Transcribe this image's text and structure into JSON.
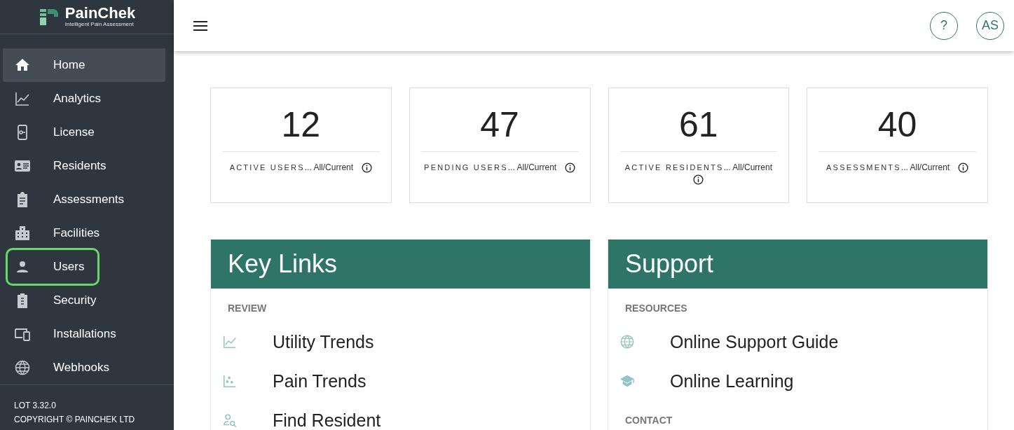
{
  "brand": {
    "name": "PainChek",
    "tagline": "Intelligent Pain Assessment"
  },
  "sidebar": {
    "items": [
      {
        "label": "Home",
        "kind": "home",
        "selected": true,
        "outlined": false
      },
      {
        "label": "Analytics",
        "kind": "chart",
        "selected": false,
        "outlined": false
      },
      {
        "label": "License",
        "kind": "license",
        "selected": false,
        "outlined": false
      },
      {
        "label": "Residents",
        "kind": "card",
        "selected": false,
        "outlined": false
      },
      {
        "label": "Assessments",
        "kind": "clipboard",
        "selected": false,
        "outlined": false
      },
      {
        "label": "Facilities",
        "kind": "building",
        "selected": false,
        "outlined": false
      },
      {
        "label": "Users",
        "kind": "person",
        "selected": false,
        "outlined": true
      },
      {
        "label": "Security",
        "kind": "badge",
        "selected": false,
        "outlined": false
      },
      {
        "label": "Installations",
        "kind": "devices",
        "selected": false,
        "outlined": false
      },
      {
        "label": "Webhooks",
        "kind": "globe",
        "selected": false,
        "outlined": false
      }
    ],
    "footer": [
      "LOT 3.32.0",
      "COPYRIGHT © PAINCHEK LTD"
    ]
  },
  "topbar": {
    "help": "?",
    "avatar": "AS"
  },
  "stats": [
    {
      "value": "12",
      "label": "ACTIVE USERS",
      "suffix": "... All/Current"
    },
    {
      "value": "47",
      "label": "PENDING USERS",
      "suffix": "... All/Current"
    },
    {
      "value": "61",
      "label": "ACTIVE RESIDENTS",
      "suffix": "... All/Current"
    },
    {
      "value": "40",
      "label": "ASSESSMENTS",
      "suffix": "... All/Current"
    }
  ],
  "panels": [
    {
      "title": "Key Links",
      "sections": [
        {
          "heading": "REVIEW",
          "links": [
            {
              "label": "Utility Trends",
              "kind": "chart"
            },
            {
              "label": "Pain Trends",
              "kind": "scatter"
            },
            {
              "label": "Find Resident",
              "kind": "personsearch"
            }
          ]
        }
      ]
    },
    {
      "title": "Support",
      "sections": [
        {
          "heading": "RESOURCES",
          "links": [
            {
              "label": "Online Support Guide",
              "kind": "globe"
            },
            {
              "label": "Online Learning",
              "kind": "school"
            }
          ]
        },
        {
          "heading": "CONTACT"
        }
      ]
    }
  ]
}
